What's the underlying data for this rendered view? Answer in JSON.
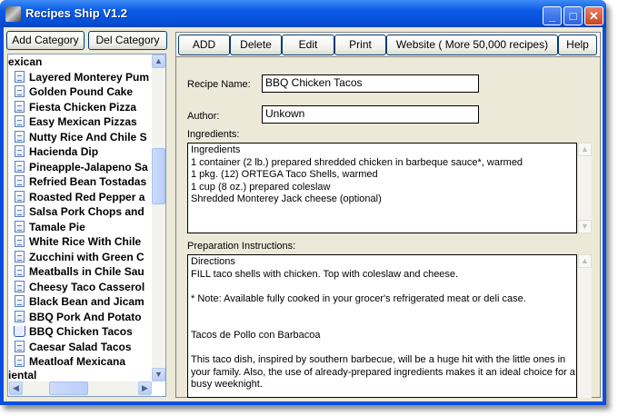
{
  "window": {
    "title": "Recipes Ship V1.2",
    "minimize": "_",
    "maximize": "□",
    "close": "✕"
  },
  "sidebar": {
    "add_category": "Add Category",
    "del_category": "Del Category",
    "category_top": "exican",
    "items": [
      "Layered Monterey Pum",
      "Golden Pound Cake",
      "Fiesta Chicken Pizza",
      "Easy Mexican Pizzas",
      "Nutty Rice And Chile S",
      "Hacienda Dip",
      "Pineapple-Jalapeno Sa",
      "Refried Bean Tostadas",
      "Roasted Red Pepper a",
      "Salsa Pork Chops and",
      "Tamale Pie",
      "White Rice With Chile",
      "Zucchini with Green C",
      "Meatballs in Chile Sau",
      "Cheesy Taco Casserol",
      "Black Bean and Jicam",
      "BBQ Pork And Potato",
      "BBQ Chicken Tacos",
      "Caesar Salad Tacos",
      "Meatloaf Mexicana"
    ],
    "selected_item": "BBQ Chicken Tacos",
    "category_bottom": "iental"
  },
  "toolbar": {
    "add": "ADD",
    "delete": "Delete",
    "edit": "Edit",
    "print": "Print",
    "website": "Website ( More 50,000 recipes)",
    "help": "Help"
  },
  "form": {
    "recipe_name_label": "Recipe Name:",
    "recipe_name": "BBQ Chicken Tacos",
    "author_label": "Author:",
    "author": "Unkown",
    "ingredients_label": "Ingredients:",
    "ingredients": [
      "Ingredients",
      "1 container (2 lb.) prepared shredded chicken in barbeque sauce*, warmed",
      "1 pkg. (12) ORTEGA Taco Shells, warmed",
      "1 cup (8 oz.) prepared coleslaw",
      "Shredded Monterey Jack cheese (optional)"
    ],
    "instructions_label": "Preparation Instructions:",
    "instructions": [
      "Directions",
      "FILL taco shells with chicken. Top with coleslaw and cheese.",
      "",
      "* Note: Available fully cooked in your grocer's refrigerated meat or deli case.",
      "",
      "",
      "Tacos de Pollo con Barbacoa",
      "",
      "This taco dish, inspired by southern barbecue, will be a huge hit with the little ones in",
      "your family. Also, the use of already-prepared ingredients makes it an ideal choice for a",
      "busy weeknight."
    ]
  }
}
